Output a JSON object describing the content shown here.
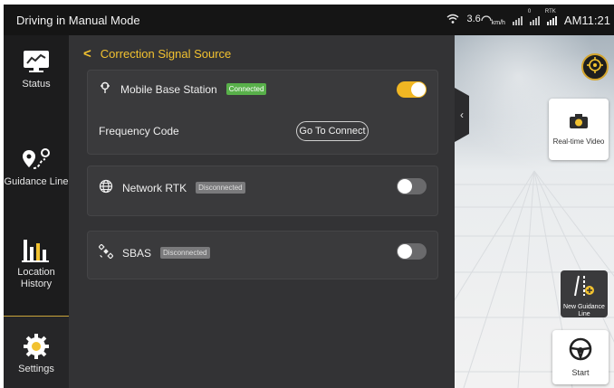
{
  "status_bar": {
    "title": "Driving in Manual Mode",
    "speed_value": "3.6",
    "speed_unit": "km/h",
    "satellites": "0",
    "rtk_label": "RTK",
    "time": "AM11:21"
  },
  "nav": {
    "items": [
      {
        "label": "Status",
        "icon": "status-monitor-icon"
      },
      {
        "label": "Guidance Line",
        "icon": "guidance-line-icon"
      },
      {
        "label": "Location History",
        "icon": "location-history-icon"
      },
      {
        "label": "Settings",
        "icon": "gear-icon"
      }
    ],
    "active": "Settings"
  },
  "panel": {
    "title": "Correction Signal Source",
    "mobile_base_station": {
      "label": "Mobile Base Station",
      "status": "Connected",
      "enabled": true,
      "frequency_label": "Frequency Code",
      "connect_button": "Go To Connect"
    },
    "network_rtk": {
      "label": "Network RTK",
      "status": "Disconnected",
      "enabled": false
    },
    "sbas": {
      "label": "SBAS",
      "status": "Disconnected",
      "enabled": false
    }
  },
  "map": {
    "realtime_video": "Real-time Video",
    "new_guidance_line": "New Guidance Line",
    "start": "Start"
  },
  "colors": {
    "accent": "#f2c230",
    "connected": "#58b04a",
    "disconnected": "#7a7a7c"
  }
}
